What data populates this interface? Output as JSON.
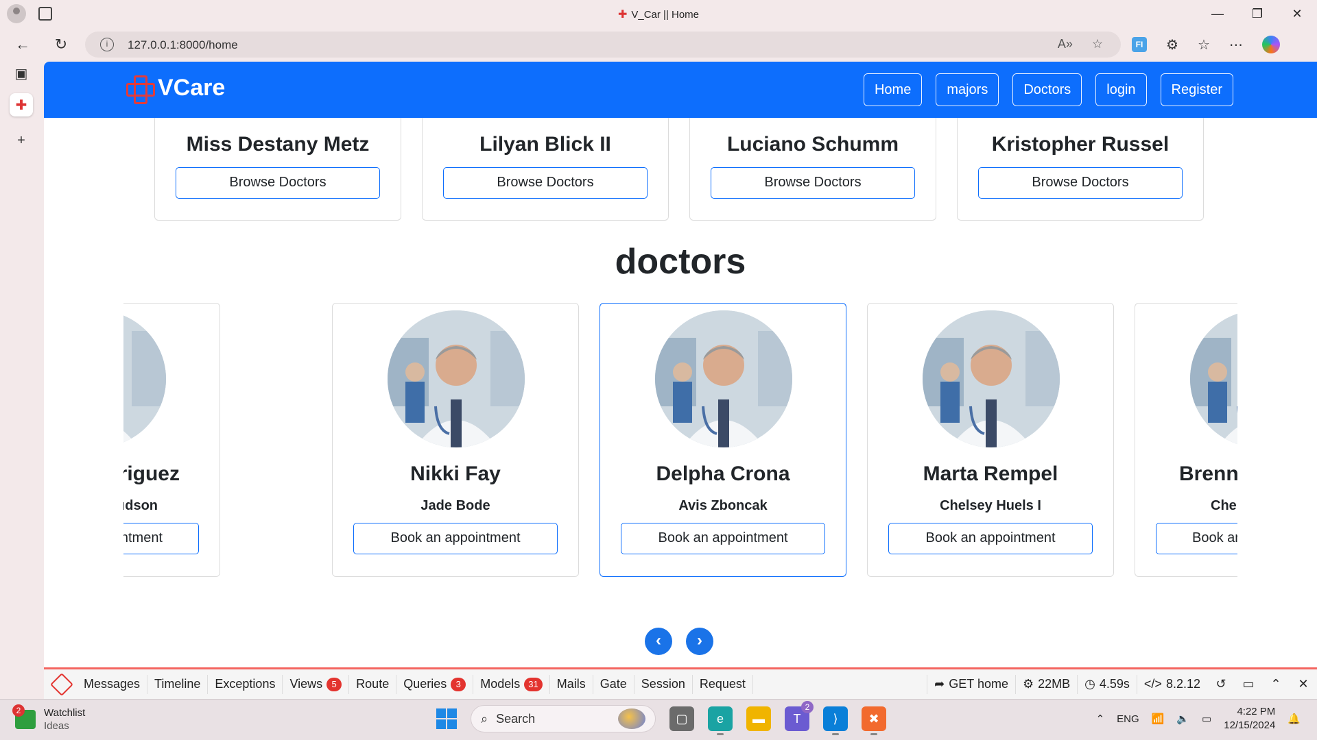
{
  "browser": {
    "tab_title": "V_Car || Home",
    "url": "127.0.0.1:8000/home"
  },
  "site": {
    "brand": "VCare",
    "nav": [
      "Home",
      "majors",
      "Doctors",
      "login",
      "Register"
    ]
  },
  "majors": [
    {
      "title": "Miss Destany Metz",
      "button": "Browse Doctors"
    },
    {
      "title": "Lilyan Blick II",
      "button": "Browse Doctors"
    },
    {
      "title": "Luciano Schumm",
      "button": "Browse Doctors"
    },
    {
      "title": "Kristopher Russel",
      "button": "Browse Doctors"
    }
  ],
  "doctors_section": {
    "title": "doctors",
    "cards": [
      {
        "name": "Rodriguez",
        "major": "Lavinia Hudson",
        "button": "Book an appointment"
      },
      {
        "name": "Nikki Fay",
        "major": "Jade Bode",
        "button": "Book an appointment"
      },
      {
        "name": "Delpha Crona",
        "major": "Avis Zboncak",
        "button": "Book an appointment"
      },
      {
        "name": "Marta Rempel",
        "major": "Chelsey Huels I",
        "button": "Book an appointment"
      },
      {
        "name": "Brennon L",
        "major": "Chelsey Huels I",
        "button": "Book an appointment"
      }
    ],
    "prev_icon": "chevron-left-icon",
    "next_icon": "chevron-right-icon"
  },
  "debugbar": {
    "items": [
      {
        "label": "Messages",
        "badge": ""
      },
      {
        "label": "Timeline",
        "badge": ""
      },
      {
        "label": "Exceptions",
        "badge": ""
      },
      {
        "label": "Views",
        "badge": "5"
      },
      {
        "label": "Route",
        "badge": ""
      },
      {
        "label": "Queries",
        "badge": "3"
      },
      {
        "label": "Models",
        "badge": "31"
      },
      {
        "label": "Mails",
        "badge": ""
      },
      {
        "label": "Gate",
        "badge": ""
      },
      {
        "label": "Session",
        "badge": ""
      },
      {
        "label": "Request",
        "badge": ""
      }
    ],
    "route": "GET home",
    "memory": "22MB",
    "time": "4.59s",
    "php_version": "8.2.12",
    "accent_color": "#e3342f"
  },
  "taskbar": {
    "widget_title": "Watchlist",
    "widget_sub": "Ideas",
    "widget_badge": "2",
    "search_placeholder": "Search",
    "teams_badge": "2",
    "language": "ENG",
    "time": "4:22 PM",
    "date": "12/15/2024"
  },
  "colors": {
    "primary": "#0d6efd",
    "brand_cross": "#e23b3b"
  }
}
